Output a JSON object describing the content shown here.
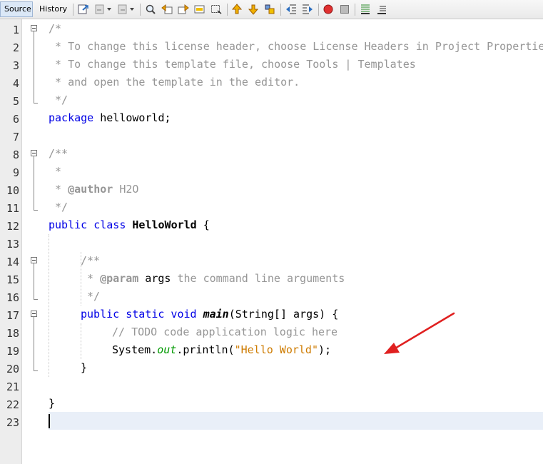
{
  "tabs": {
    "source": "Source",
    "history": "History"
  },
  "toolbar_icons": [
    "last-edit-icon",
    "back-icon",
    "forward-icon",
    "find-selection-icon",
    "find-previous-icon",
    "find-next-icon",
    "toggle-highlight-icon",
    "toggle-rect-select-icon",
    "previous-bookmark-icon",
    "next-bookmark-icon",
    "toggle-bookmark-icon",
    "shift-left-icon",
    "shift-right-icon",
    "start-macro-icon",
    "stop-macro-icon",
    "comment-icon",
    "uncomment-icon"
  ],
  "line_numbers": [
    "1",
    "2",
    "3",
    "4",
    "5",
    "6",
    "7",
    "8",
    "9",
    "10",
    "11",
    "12",
    "13",
    "14",
    "15",
    "16",
    "17",
    "18",
    "19",
    "20",
    "21",
    "22",
    "23"
  ],
  "code": {
    "l1": "/*",
    "l2": " * To change this license header, choose License Headers in Project Properties.",
    "l3": " * To change this template file, choose Tools | Templates",
    "l4": " * and open the template in the editor.",
    "l5": " */",
    "l6_kw": "package",
    "l6_rest": " helloworld;",
    "l8": "/**",
    "l9": " *",
    "l10_pre": " * ",
    "l10_tag": "@author",
    "l10_post": " H2O",
    "l11": " */",
    "l12_kw": "public class",
    "l12_sp": " ",
    "l12_name": "HelloWorld",
    "l12_rest": " {",
    "l14": "/**",
    "l15_pre": " * ",
    "l15_tag": "@param",
    "l15_arg": " args",
    "l15_post": " the command line arguments",
    "l16": " */",
    "l17_kw": "public static void",
    "l17_sp": " ",
    "l17_name": "main",
    "l17_rest": "(String[] args) {",
    "l18": "// TODO code application logic here",
    "l19_pre": "System.",
    "l19_field": "out",
    "l19_mid": ".println(",
    "l19_str": "\"Hello World\"",
    "l19_post": ");",
    "l20": "}",
    "l22": "}"
  },
  "colors": {
    "keyword": "#0000e6",
    "comment": "#969696",
    "string": "#ce7b00",
    "field": "#009900",
    "arrow": "#e02020"
  }
}
